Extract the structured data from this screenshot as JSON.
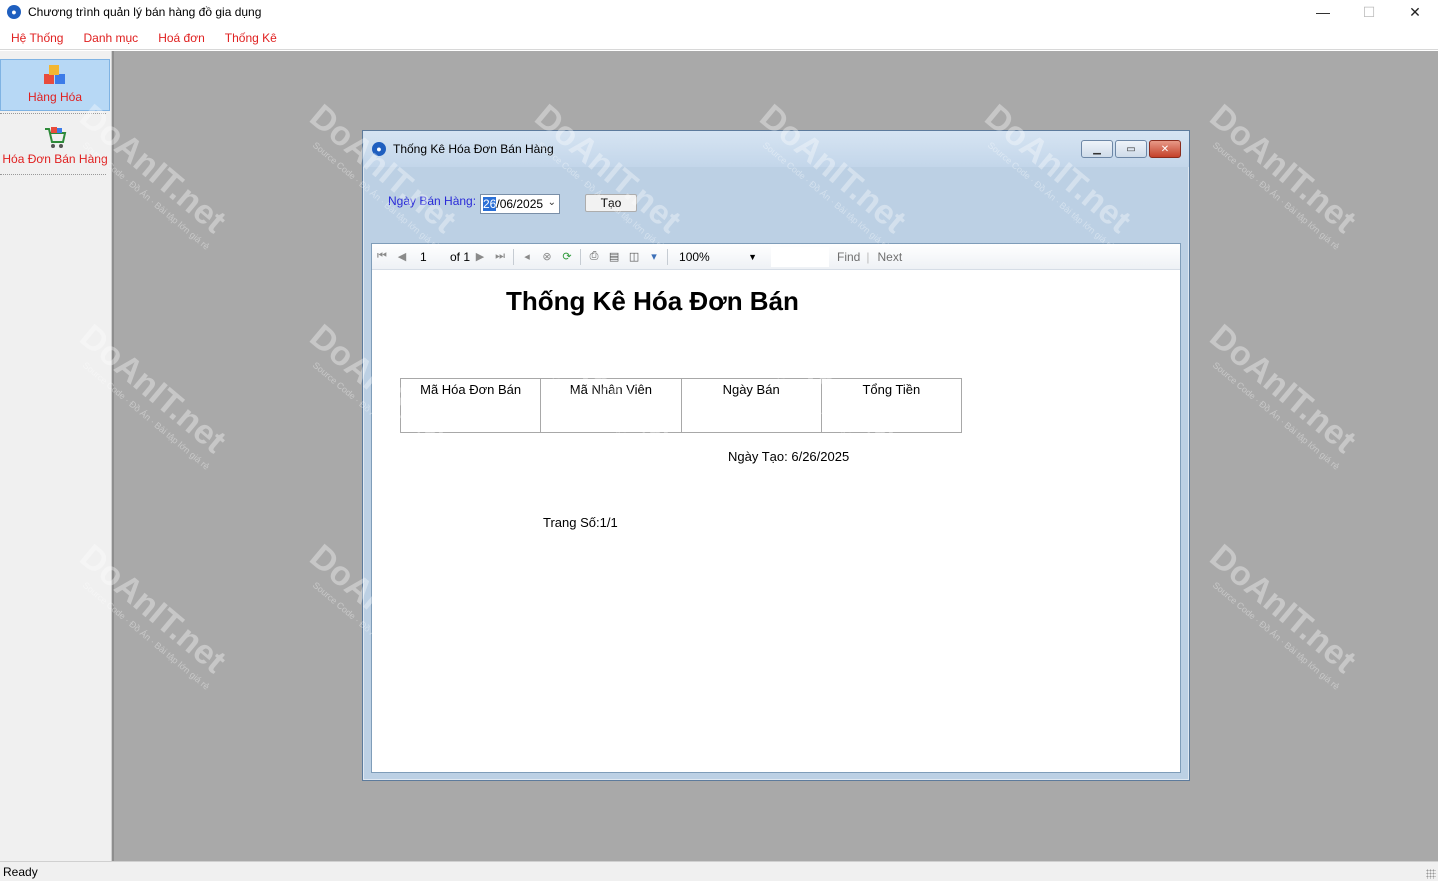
{
  "app": {
    "title": "Chương trình quản lý bán hàng đồ gia dụng",
    "controls": {
      "minimize": "—",
      "maximize": "☐",
      "close": "✕"
    }
  },
  "menu": {
    "items": [
      {
        "label": "Hệ Thống"
      },
      {
        "label": "Danh mục"
      },
      {
        "label": "Hoá đơn"
      },
      {
        "label": "Thống Kê"
      }
    ]
  },
  "sidebar": {
    "items": [
      {
        "label": "Hàng Hóa",
        "icon": "boxes-icon",
        "selected": true
      },
      {
        "label": "Hóa Đơn Bán Hàng",
        "icon": "shopping-cart-icon",
        "selected": false
      }
    ]
  },
  "status": {
    "text": "Ready"
  },
  "child_window": {
    "title": "Thống Kê Hóa Đơn Bán Hàng",
    "filter": {
      "label": "Ngày Bán Hàng:",
      "date_day": "26",
      "date_rest": "/06/2025",
      "button": "Tạo"
    },
    "toolbar": {
      "page": "1",
      "of_label": "of 1",
      "zoom": "100%",
      "find": "Find",
      "next": "Next"
    },
    "report": {
      "title": "Thống Kê Hóa Đơn Bán",
      "columns": [
        "Mã Hóa Đơn Bán",
        "Mã Nhân Viên",
        "Ngày Bán",
        "Tổng Tiền"
      ],
      "created": "Ngày Tạo: 6/26/2025",
      "page": "Trang Số:1/1"
    }
  },
  "watermark": {
    "text": "DoAnIT.net",
    "sub": "Source Code · Đồ Án · Bài tập lớn giá rẻ"
  }
}
